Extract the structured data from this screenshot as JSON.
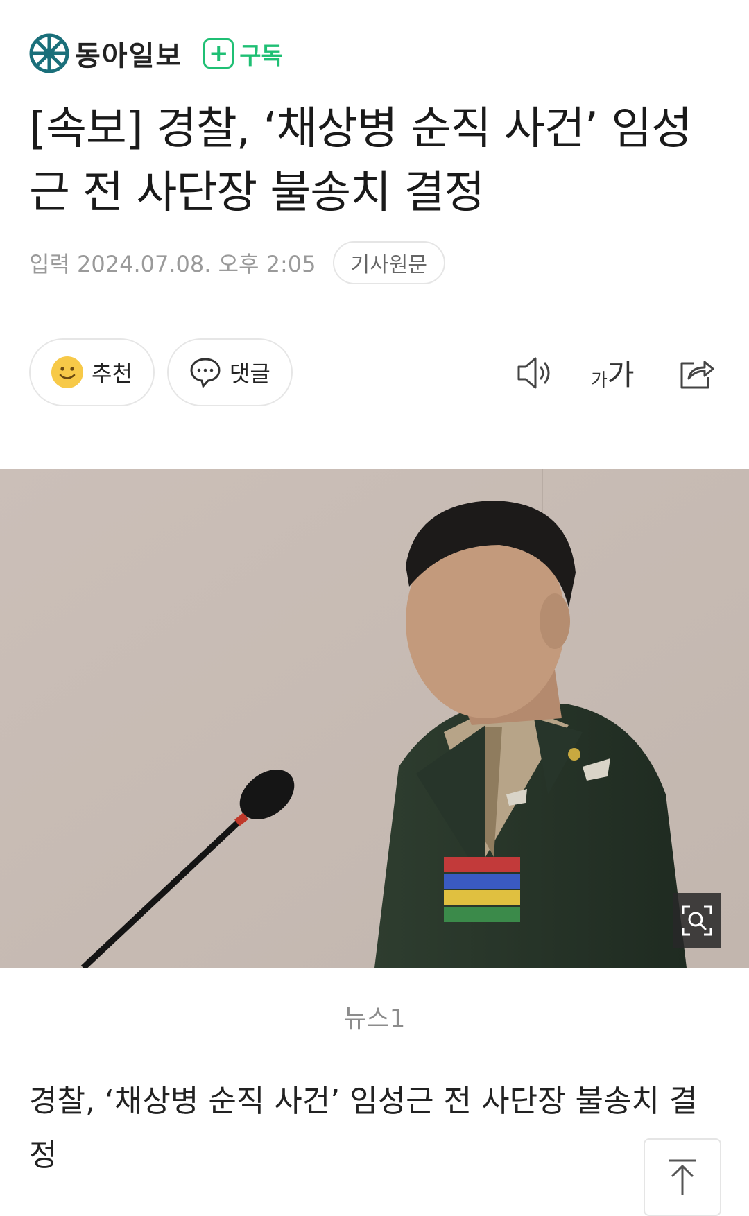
{
  "header": {
    "brand": "동아일보",
    "subscribe_label": "구독"
  },
  "article": {
    "title": "[속보] 경찰, ‘채상병 순직 사건’ 임성근 전 사단장 불송치 결정",
    "date": "입력 2024.07.08. 오후 2:05",
    "original_label": "기사원문",
    "photo_credit": "뉴스1",
    "subtitle": "경찰, ‘채상병 순직 사건’ 임성근 전 사단장 불송치 결정"
  },
  "actions": {
    "recommend_label": "추천",
    "comment_label": "댓글"
  },
  "toolbar": {
    "font_small": "가",
    "font_large": "가"
  },
  "icons": {
    "logo": "dongailbo-logo-icon",
    "recommend": "smiley-icon",
    "comment": "speech-bubble-icon",
    "audio": "speaker-icon",
    "share": "share-icon",
    "zoom": "magnify-icon",
    "top": "scroll-top-icon"
  },
  "colors": {
    "brand": "#1a6f7a",
    "subscribe": "#1fbf74"
  }
}
